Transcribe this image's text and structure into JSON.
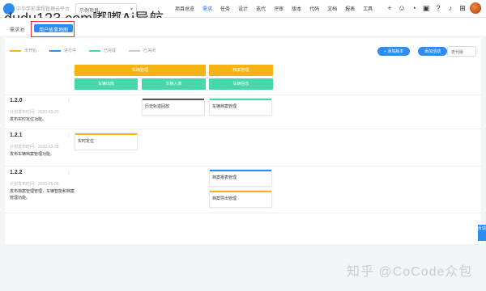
{
  "topbar": {
    "logo_text": "中华学前课程管理云平台",
    "project_select": "示例项目",
    "nav": [
      "项目总览",
      "需求",
      "任务",
      "设计",
      "迭代",
      "评审",
      "版本",
      "代码",
      "文档",
      "报表",
      "工具"
    ],
    "nav_active_index": 1,
    "watermark": "dudu123.com嘟嘟Ai导航"
  },
  "subbar": {
    "tab1": "需求池",
    "tab2": "用户故事地图"
  },
  "legend": [
    {
      "label": "未开始",
      "color": "#f3b414"
    },
    {
      "label": "进行中",
      "color": "#2d8cf0"
    },
    {
      "label": "已完成",
      "color": "#47d7ab"
    },
    {
      "label": "已关闭",
      "color": "#c9cdd2"
    }
  ],
  "toolbar": {
    "add_version": "+ 添加版本",
    "add_activity": "添加活动",
    "version_select": "迭代版"
  },
  "activities": [
    {
      "label": "车辆管理"
    },
    {
      "label": "档案管理"
    }
  ],
  "tasks": [
    {
      "label": "车辆出库"
    },
    {
      "label": "车辆入库"
    },
    {
      "label": "车辆信息"
    }
  ],
  "versions": [
    {
      "title": "1.2.0",
      "date": "计划发布时间：2020-03-20",
      "desc": "发布实时定位功能。"
    },
    {
      "title": "1.2.1",
      "date": "计划发布时间：2020-03-28",
      "desc": "发布车辆档案管理功能。"
    },
    {
      "title": "1.2.2",
      "date": "计划发布时间：2020-05-06",
      "desc": "发布档案管理管理，车辆智能和档案管理功能。"
    }
  ],
  "cards": {
    "v0_task2": "历史轨迹回放",
    "v0_task3": "车辆档案管理",
    "v1_task1": "实时定位",
    "v2_task3a": "档案报表管理",
    "v2_task3b": "档案导出管理"
  },
  "footer": {
    "watermark": "知乎 @CoCode众包"
  },
  "side_tab": "反馈"
}
